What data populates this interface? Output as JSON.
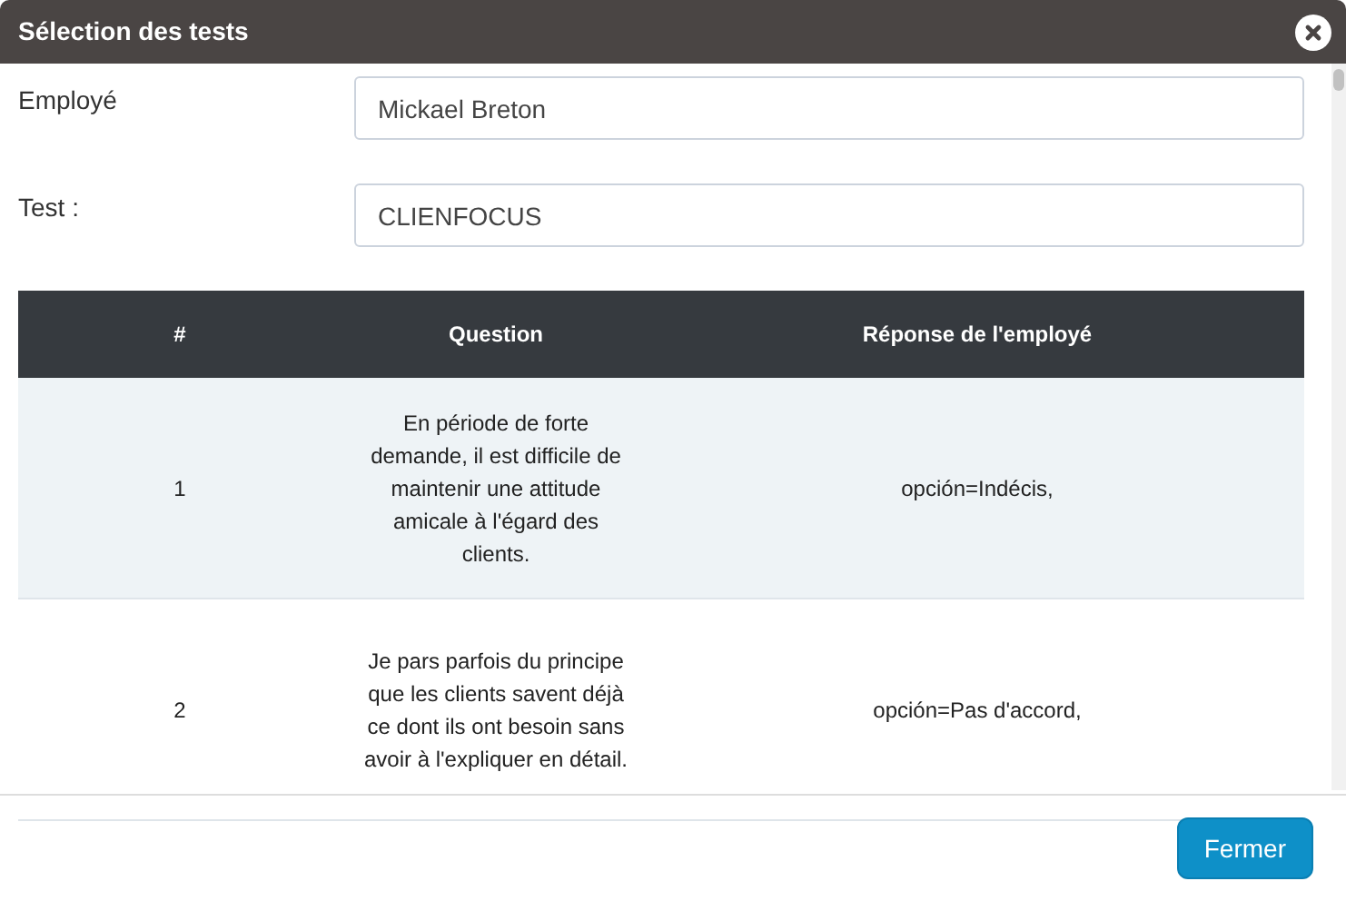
{
  "window": {
    "title": "Sélection des tests"
  },
  "fields": [
    {
      "label": "Employé",
      "value": "Mickael Breton"
    },
    {
      "label": "Test :",
      "value": "CLIENFOCUS"
    }
  ],
  "table": {
    "columns": [
      "#",
      "Question",
      "Réponse de l'employé"
    ],
    "rows": [
      {
        "cells": [
          "1",
          "En période de forte demande, il est difficile de maintenir une attitude amicale à l'égard des clients.",
          "opción=Indécis,"
        ],
        "shaded": true
      },
      {
        "cells": [
          "2",
          "Je pars parfois du principe que les clients savent déjà ce dont ils ont besoin sans avoir à l'expliquer en détail.",
          "opción=Pas d'accord,"
        ],
        "shaded": false
      }
    ]
  },
  "buttons": [
    "Fermer"
  ]
}
